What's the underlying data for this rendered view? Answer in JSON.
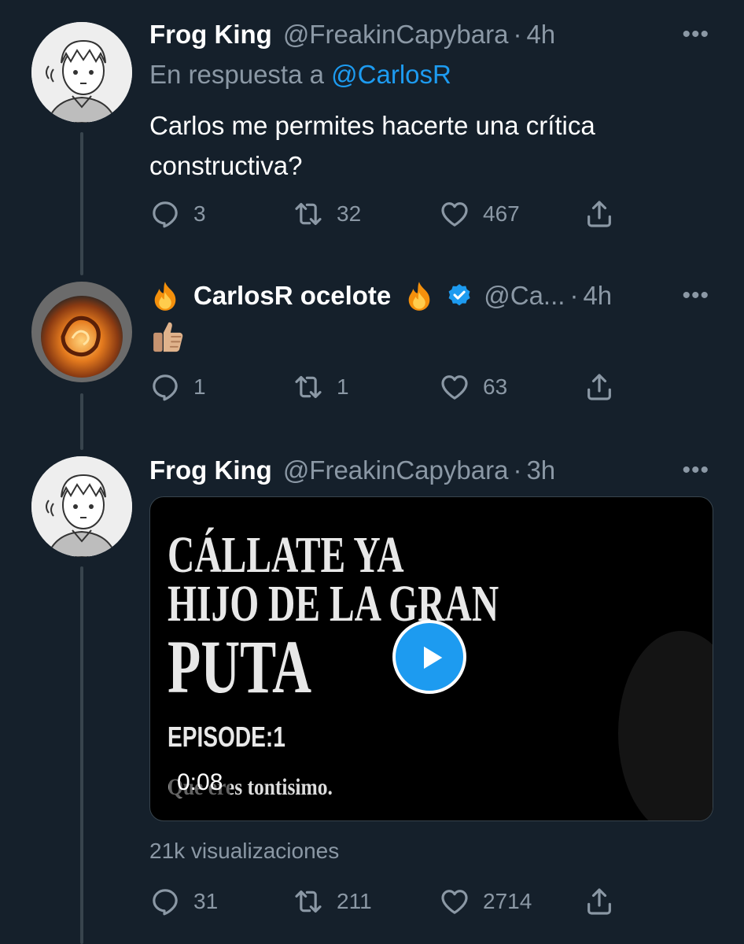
{
  "tweets": [
    {
      "name": "Frog King",
      "handle": "@FreakinCapybara",
      "time": "4h",
      "reply_prefix": "En respuesta a",
      "reply_mention": "@CarlosR",
      "text": "Carlos me permites hacerte una crítica constructiva?",
      "replies": "3",
      "retweets": "32",
      "likes": "467"
    },
    {
      "name": "CarlosR ocelote",
      "handle": "@Ca...",
      "time": "4h",
      "verified": true,
      "name_emoji": "fire-emoji",
      "text_emoji": "thumbs-up-emoji",
      "replies": "1",
      "retweets": "1",
      "likes": "63"
    },
    {
      "name": "Frog King",
      "handle": "@FreakinCapybara",
      "time": "3h",
      "video": {
        "line1": "CÁLLATE YA",
        "line2": "HIJO DE LA GRAN",
        "line3": "PUTA",
        "episode": "EPISODE:1",
        "subtitle": "Que eres tontisimo.",
        "duration": "0:08"
      },
      "views": "21k visualizaciones",
      "replies": "31",
      "retweets": "211",
      "likes": "2714"
    }
  ],
  "colors": {
    "background": "#15202b",
    "muted": "#8b98a5",
    "accent": "#1d9bf0",
    "thread_line": "#38444d"
  }
}
